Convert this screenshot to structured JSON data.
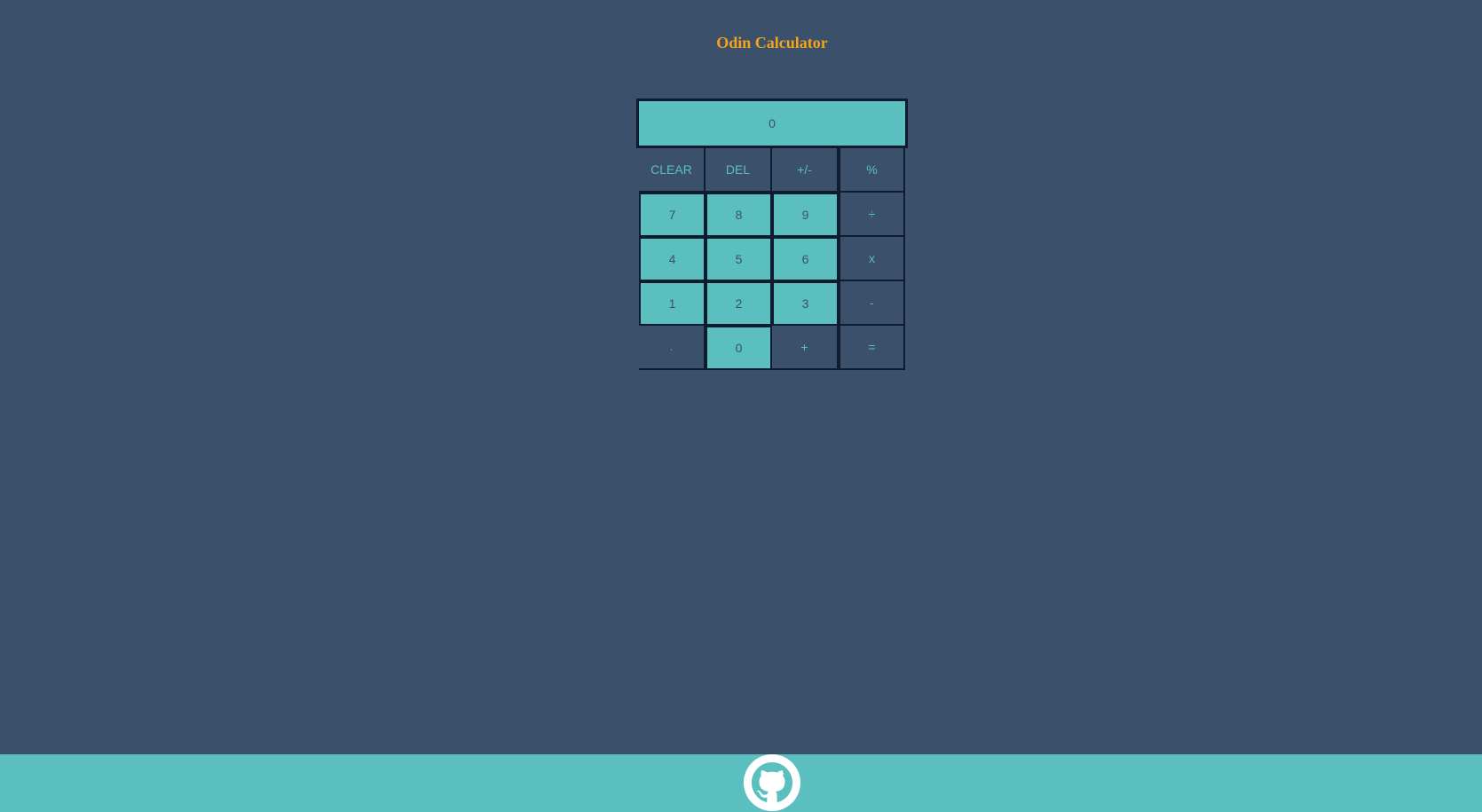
{
  "title": "Odin Calculator",
  "display": {
    "value": "0"
  },
  "keys": [
    {
      "label": "CLEAR",
      "name": "clear-button",
      "style": "dark",
      "col": 1
    },
    {
      "label": "DEL",
      "name": "delete-button",
      "style": "dark",
      "col": 2
    },
    {
      "label": "+/-",
      "name": "toggle-sign-button",
      "style": "dark",
      "col": 3
    },
    {
      "label": "%",
      "name": "percent-button",
      "style": "dark",
      "col": 4
    },
    {
      "label": "7",
      "name": "digit-7-button",
      "style": "num",
      "col": 1
    },
    {
      "label": "8",
      "name": "digit-8-button",
      "style": "num",
      "col": 2
    },
    {
      "label": "9",
      "name": "digit-9-button",
      "style": "num",
      "col": 3
    },
    {
      "label": "÷",
      "name": "divide-button",
      "style": "dark",
      "col": 4
    },
    {
      "label": "4",
      "name": "digit-4-button",
      "style": "num",
      "col": 1
    },
    {
      "label": "5",
      "name": "digit-5-button",
      "style": "num",
      "col": 2
    },
    {
      "label": "6",
      "name": "digit-6-button",
      "style": "num",
      "col": 3
    },
    {
      "label": "x",
      "name": "multiply-button",
      "style": "dark",
      "col": 4
    },
    {
      "label": "1",
      "name": "digit-1-button",
      "style": "num",
      "col": 1
    },
    {
      "label": "2",
      "name": "digit-2-button",
      "style": "num",
      "col": 2
    },
    {
      "label": "3",
      "name": "digit-3-button",
      "style": "num",
      "col": 3
    },
    {
      "label": "-",
      "name": "subtract-button",
      "style": "dark",
      "col": 4
    },
    {
      "label": ".",
      "name": "decimal-button",
      "style": "dark",
      "col": 1
    },
    {
      "label": "0",
      "name": "digit-0-button",
      "style": "num",
      "col": 2
    },
    {
      "label": "+",
      "name": "add-button",
      "style": "dark",
      "col": 3
    },
    {
      "label": "=",
      "name": "equals-button",
      "style": "dark",
      "col": 4
    }
  ],
  "footer": {
    "icon": "github-icon"
  },
  "colors": {
    "background": "#3b506b",
    "accent": "#5bbfbf",
    "title": "#f5a31a",
    "border": "#0f1b2e"
  }
}
